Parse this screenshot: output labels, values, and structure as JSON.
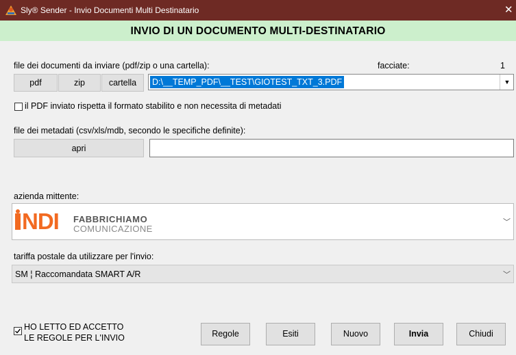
{
  "window": {
    "title": "Sly® Sender - Invio Documenti Multi Destinatario",
    "close_glyph": "✕"
  },
  "header": {
    "title": "INVIO DI UN DOCUMENTO MULTI-DESTINATARIO"
  },
  "documents": {
    "label": "file dei documenti da inviare (pdf/zip o una cartella):",
    "pages_label": "facciate:",
    "pages_value": "1",
    "btn_pdf": "pdf",
    "btn_zip": "zip",
    "btn_folder": "cartella",
    "path_value": "D:\\__TEMP_PDF\\__TEST\\GIOTEST_TXT_3.PDF"
  },
  "pdf_check": {
    "label": "il PDF inviato rispetta il formato stabilito e non necessita di metadati",
    "checked": false
  },
  "metadata": {
    "label": "file dei metadati (csv/xls/mdb, secondo le specifiche definite):",
    "btn_open": "apri",
    "path_value": ""
  },
  "sender": {
    "label": "azienda mittente:",
    "logo_main": "NDI",
    "logo_line1": "FABBRICHIAMO",
    "logo_line2": "COMUNICAZIONE"
  },
  "tariff": {
    "label": "tariffa postale da utilizzare per l'invio:",
    "selected": "SM ¦ Raccomandata SMART A/R"
  },
  "accept": {
    "line1": "HO LETTO ED ACCETTO",
    "line2": "LE REGOLE PER L'INVIO",
    "checked": true
  },
  "footer_buttons": {
    "rules": "Regole",
    "results": "Esiti",
    "new": "Nuovo",
    "send": "Invia",
    "close": "Chiudi"
  },
  "colors": {
    "titlebar": "#6e2a24",
    "header": "#ccefcc",
    "selection": "#0078d7",
    "logo_orange": "#f26a21"
  }
}
